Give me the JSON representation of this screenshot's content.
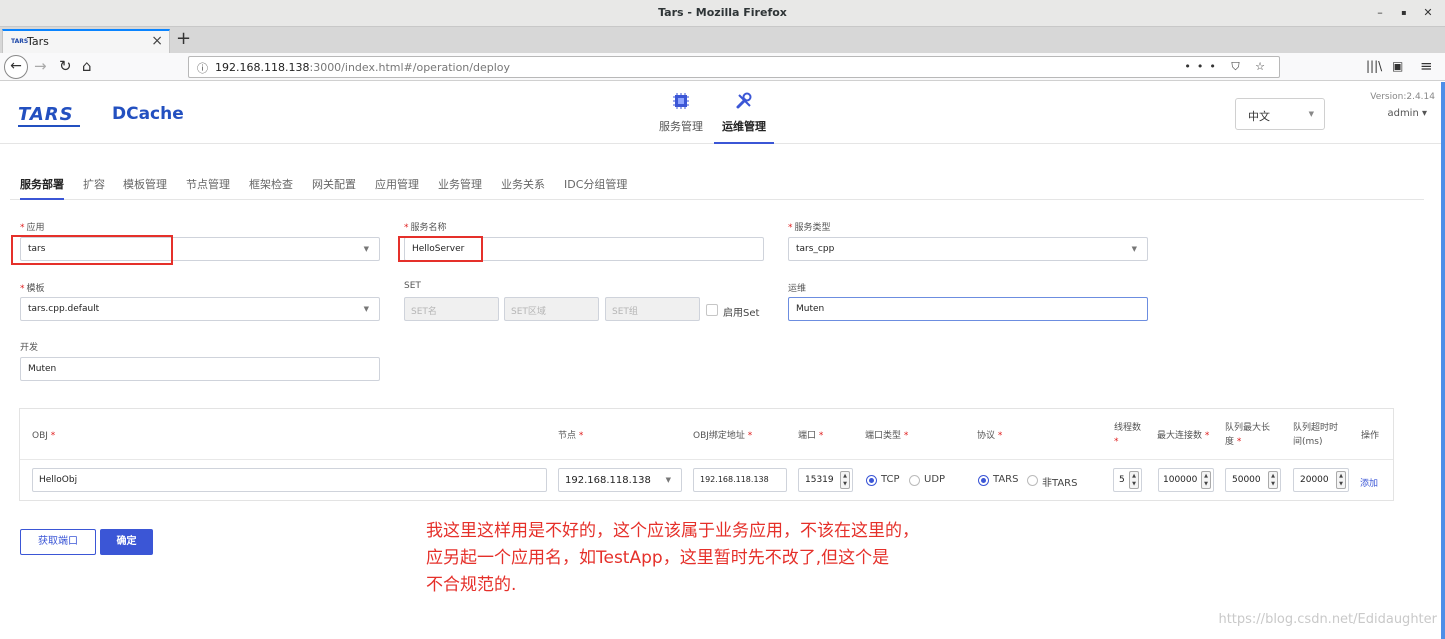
{
  "window": {
    "title": "Tars - Mozilla Firefox",
    "min_icon": "minimize-icon",
    "max_icon": "maximize-icon",
    "close_icon": "close-icon"
  },
  "browser": {
    "tab_title": "Tars",
    "tab_favicon_text": "TARS",
    "url_host": "192.168.118.138",
    "url_rest": ":3000/index.html#/operation/deploy",
    "url_actions": "••• ⛉ ☆",
    "nav_icons": [
      "back-icon",
      "forward-icon",
      "reload-icon",
      "home-icon",
      "library-icon",
      "sidebar-icon",
      "menu-icon"
    ]
  },
  "header": {
    "logo_tars": "TARS",
    "logo_dcache": "DCache",
    "nav": [
      {
        "label": "服务管理",
        "icon": "chip-icon",
        "active": false
      },
      {
        "label": "运维管理",
        "icon": "tools-icon",
        "active": true
      }
    ],
    "language": "中文",
    "version": "Version:2.4.14",
    "user": "admin ▾",
    "accent": "#3b56d6"
  },
  "subtabs": [
    "服务部署",
    "扩容",
    "模板管理",
    "节点管理",
    "框架检查",
    "网关配置",
    "应用管理",
    "业务管理",
    "业务关系",
    "IDC分组管理"
  ],
  "form": {
    "app_label": "应用",
    "app_value": "tars",
    "server_label": "服务名称",
    "server_value": "HelloServer",
    "type_label": "服务类型",
    "type_value": "tars_cpp",
    "template_label": "模板",
    "template_value": "tars.cpp.default",
    "set_label": "SET",
    "set_name_ph": "SET名",
    "set_area_ph": "SET区域",
    "set_group_ph": "SET组",
    "enable_set": "启用Set",
    "ops_label": "运维",
    "ops_value": "Muten",
    "dev_label": "开发",
    "dev_value": "Muten",
    "required_mark": "*"
  },
  "table": {
    "headers": {
      "obj": "OBJ",
      "node": "节点",
      "bind": "OBJ绑定地址",
      "port": "端口",
      "port_type": "端口类型",
      "protocol": "协议",
      "threads_1": "线程数",
      "max_conn": "最大连接数",
      "queue_len_1": "队列最大长",
      "queue_len_2": "度",
      "queue_timeout_1": "队列超时时",
      "queue_timeout_2": "间(ms)",
      "op": "操作"
    },
    "row": {
      "obj": "HelloObj",
      "node": "192.168.118.138",
      "bind": "192.168.118.138",
      "port": "15319",
      "port_type_tcp": "TCP",
      "port_type_udp": "UDP",
      "protocol_tars": "TARS",
      "protocol_non": "非TARS",
      "threads": "5",
      "max_conn": "100000",
      "queue_len": "50000",
      "queue_timeout": "20000",
      "add": "添加"
    }
  },
  "buttons": {
    "get_port": "获取端口",
    "confirm": "确定"
  },
  "annotation": {
    "line1": "我这里这样用是不好的，这个应该属于业务应用，不该在这里的，",
    "line2": "应另起一个应用名，如TestApp，这里暂时先不改了,但这个是",
    "line3": "不合规范的.",
    "color": "#e5302a"
  },
  "watermark": "https://blog.csdn.net/Edidaughter"
}
